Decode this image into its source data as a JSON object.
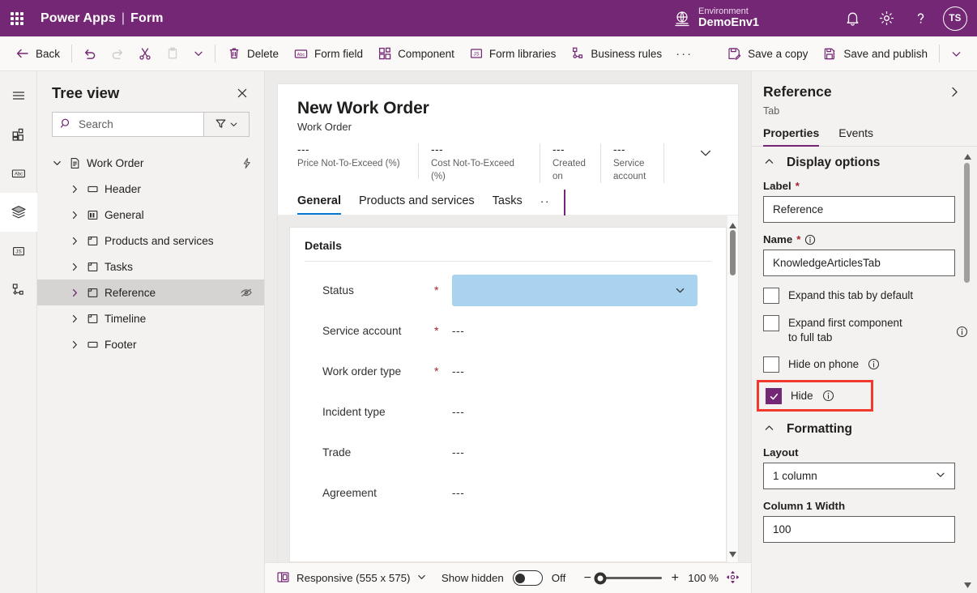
{
  "brand": {
    "waffle_icon": "waffle-icon",
    "product": "Power Apps",
    "separator": "|",
    "section": "Form",
    "environment_label": "Environment",
    "environment_name": "DemoEnv1",
    "notifications_icon": "bell-icon",
    "settings_icon": "gear-icon",
    "help_icon": "question-mark-icon",
    "avatar_initials": "TS",
    "bg_color": "#742774"
  },
  "commandbar": {
    "back": "Back",
    "undo_icon": "undo-icon",
    "redo_icon": "redo-icon",
    "cut_icon": "scissors-icon",
    "paste_icon": "clipboard-icon",
    "paste_chevron_icon": "chevron-down-icon",
    "delete": "Delete",
    "form_field": "Form field",
    "component": "Component",
    "form_libraries": "Form libraries",
    "business_rules": "Business rules",
    "overflow": "···",
    "save_a_copy": "Save a copy",
    "save_and_publish": "Save and publish",
    "more_chevron_icon": "chevron-down-icon"
  },
  "rail": {
    "items": [
      {
        "icon": "hamburger-menu-icon",
        "name": "tree-view",
        "active": false
      },
      {
        "icon": "components-icon",
        "name": "components",
        "active": false
      },
      {
        "icon": "abc-field-icon",
        "name": "table-columns",
        "active": false
      },
      {
        "icon": "layers-icon",
        "name": "form-layers",
        "active": true
      },
      {
        "icon": "js-script-icon",
        "name": "form-libraries",
        "active": false
      },
      {
        "icon": "business-rules-icon",
        "name": "business-rules",
        "active": false
      }
    ]
  },
  "treeview": {
    "title": "Tree view",
    "close_icon": "close-icon",
    "search_placeholder": "Search",
    "search_value": "",
    "search_icon": "search-icon",
    "filter_icon": "filter-icon",
    "filter_chevron_icon": "chevron-down-icon",
    "nodes": [
      {
        "label": "Work Order",
        "level": 0,
        "icon": "form-page-icon",
        "expanded": true,
        "selected": false,
        "right_icon": "lightning-bolt-icon"
      },
      {
        "label": "Header",
        "level": 1,
        "icon": "header-region-icon",
        "expanded": false,
        "selected": false,
        "right_icon": ""
      },
      {
        "label": "General",
        "level": 1,
        "icon": "tab-columns-icon",
        "expanded": false,
        "selected": false,
        "right_icon": ""
      },
      {
        "label": "Products and services",
        "level": 1,
        "icon": "tab-icon",
        "expanded": false,
        "selected": false,
        "right_icon": ""
      },
      {
        "label": "Tasks",
        "level": 1,
        "icon": "tab-icon",
        "expanded": false,
        "selected": false,
        "right_icon": ""
      },
      {
        "label": "Reference",
        "level": 1,
        "icon": "tab-icon",
        "expanded": false,
        "selected": true,
        "right_icon": "hidden-eye-icon"
      },
      {
        "label": "Timeline",
        "level": 1,
        "icon": "tab-icon",
        "expanded": false,
        "selected": false,
        "right_icon": ""
      },
      {
        "label": "Footer",
        "level": 1,
        "icon": "header-region-icon",
        "expanded": false,
        "selected": false,
        "right_icon": ""
      }
    ]
  },
  "canvas": {
    "form_title": "New Work Order",
    "form_subtitle": "Work Order",
    "header_fields": [
      {
        "value": "---",
        "caption": "Price Not-To-Exceed (%)"
      },
      {
        "value": "---",
        "caption": "Cost Not-To-Exceed (%)"
      },
      {
        "value": "---",
        "caption": "Created on"
      },
      {
        "value": "---",
        "caption": "Service account"
      }
    ],
    "header_chevron_icon": "chevron-down-icon",
    "tabs": [
      {
        "label": "General",
        "active": true
      },
      {
        "label": "Products and services",
        "active": false
      },
      {
        "label": "Tasks",
        "active": false
      }
    ],
    "tabs_overflow": "··",
    "section_title": "Details",
    "fields": [
      {
        "label": "Status",
        "required": true,
        "value": "",
        "control": "dropdown",
        "selected": true
      },
      {
        "label": "Service account",
        "required": true,
        "value": "---",
        "control": "text",
        "selected": false
      },
      {
        "label": "Work order type",
        "required": true,
        "value": "---",
        "control": "text",
        "selected": false
      },
      {
        "label": "Incident type",
        "required": false,
        "value": "---",
        "control": "text",
        "selected": false
      },
      {
        "label": "Trade",
        "required": false,
        "value": "---",
        "control": "text",
        "selected": false
      },
      {
        "label": "Agreement",
        "required": false,
        "value": "---",
        "control": "text",
        "selected": false
      }
    ],
    "scroll_up_icon": "triangle-up-icon",
    "scroll_down_icon": "triangle-down-icon"
  },
  "statusbar": {
    "layout_icon": "responsive-layout-icon",
    "layout_label": "Responsive (555 x 575)",
    "layout_chevron_icon": "chevron-down-icon",
    "show_hidden_label": "Show hidden",
    "show_hidden_state": "Off",
    "zoom_out_icon": "minus-icon",
    "zoom_in_icon": "plus-icon",
    "zoom_value": "100 %",
    "fit_icon": "fit-to-screen-icon"
  },
  "properties": {
    "title": "Reference",
    "expand_icon": "chevron-right-icon",
    "subtitle": "Tab",
    "tabs": [
      {
        "label": "Properties",
        "active": true
      },
      {
        "label": "Events",
        "active": false
      }
    ],
    "display_options": {
      "group_title": "Display options",
      "collapse_icon": "chevron-up-icon",
      "label_field_label": "Label",
      "label_field_required": "*",
      "label_field_value": "Reference",
      "name_field_label": "Name",
      "name_field_required": "*",
      "name_field_info_icon": "info-icon",
      "name_field_value": "KnowledgeArticlesTab",
      "checkboxes": [
        {
          "label": "Expand this tab by default",
          "checked": false,
          "info": false
        },
        {
          "label": "Expand first component to full tab",
          "checked": false,
          "info": true
        },
        {
          "label": "Hide on phone",
          "checked": false,
          "info": true
        },
        {
          "label": "Hide",
          "checked": true,
          "info": true,
          "highlighted": true
        }
      ]
    },
    "formatting": {
      "group_title": "Formatting",
      "collapse_icon": "chevron-up-icon",
      "layout_label": "Layout",
      "layout_value": "1 column",
      "layout_chevron_icon": "chevron-down-icon",
      "column1_width_label": "Column 1 Width",
      "column1_width_value": "100"
    },
    "scroll_up_icon": "triangle-up-icon",
    "scroll_down_icon": "triangle-down-icon"
  }
}
